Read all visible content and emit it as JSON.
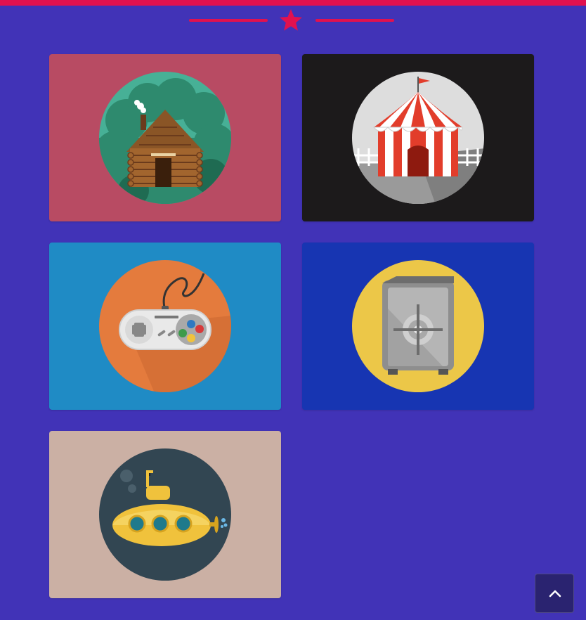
{
  "colors": {
    "page_background": "#4133b7",
    "accent": "#e1114f",
    "back_to_top_background": "#2a2370"
  },
  "header": {
    "divider_icon": "star-icon"
  },
  "portfolio": {
    "items": [
      {
        "icon": "log-cabin-icon",
        "background": "#b84b63",
        "circle": "#47b096"
      },
      {
        "icon": "circus-tent-icon",
        "background": "#1c1a1b",
        "circle": "#dddddd"
      },
      {
        "icon": "gamepad-icon",
        "background": "#1f8bc5",
        "circle": "#e47b3d"
      },
      {
        "icon": "safe-icon",
        "background": "#1735b2",
        "circle": "#ecc748"
      },
      {
        "icon": "submarine-icon",
        "background": "#cbb0a4",
        "circle": "#324652"
      }
    ]
  },
  "back_to_top": {
    "icon": "chevron-up-icon"
  }
}
